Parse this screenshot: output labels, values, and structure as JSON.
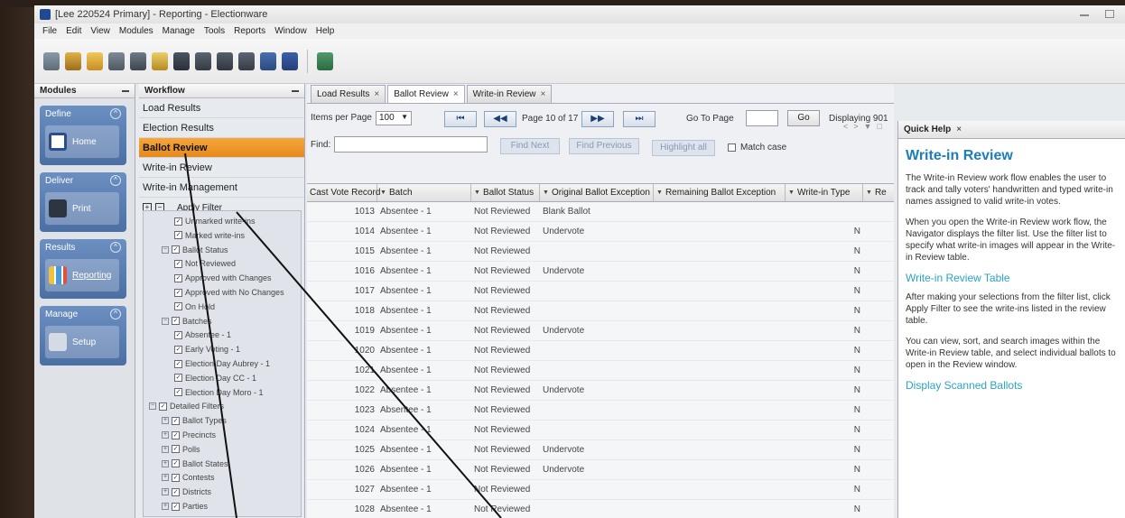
{
  "window": {
    "title": "[Lee 220524 Primary] - Reporting - Electionware"
  },
  "menu": [
    "File",
    "Edit",
    "View",
    "Modules",
    "Manage",
    "Tools",
    "Reports",
    "Window",
    "Help"
  ],
  "modules": {
    "header": "Modules",
    "sections": [
      {
        "title": "Define",
        "button": "Home"
      },
      {
        "title": "Deliver",
        "button": "Print"
      },
      {
        "title": "Results",
        "button": "Reporting"
      },
      {
        "title": "Manage",
        "button": "Setup"
      }
    ]
  },
  "workflow": {
    "header": "Workflow",
    "items": [
      "Load Results",
      "Election Results",
      "Ballot Review",
      "Write-in Review",
      "Write-in Management"
    ],
    "active_index": 2,
    "apply_filter": "Apply Filter"
  },
  "filter_tree": [
    {
      "label": "Unmarked write-ins",
      "indent": 2,
      "checked": true
    },
    {
      "label": "Marked write-ins",
      "indent": 2,
      "checked": true
    },
    {
      "label": "Ballot Status",
      "indent": 1,
      "checked": true,
      "expander": "−"
    },
    {
      "label": "Not Reviewed",
      "indent": 2,
      "checked": true
    },
    {
      "label": "Approved with Changes",
      "indent": 2,
      "checked": true
    },
    {
      "label": "Approved with No Changes",
      "indent": 2,
      "checked": true
    },
    {
      "label": "On Hold",
      "indent": 2,
      "checked": true
    },
    {
      "label": "Batches",
      "indent": 1,
      "checked": true,
      "expander": "−"
    },
    {
      "label": "Absentee - 1",
      "indent": 2,
      "checked": true
    },
    {
      "label": "Early Voting - 1",
      "indent": 2,
      "checked": true
    },
    {
      "label": "Election Day Aubrey - 1",
      "indent": 2,
      "checked": true
    },
    {
      "label": "Election Day CC - 1",
      "indent": 2,
      "checked": true
    },
    {
      "label": "Election Day Moro - 1",
      "indent": 2,
      "checked": true
    },
    {
      "label": "Detailed Filters",
      "indent": 0,
      "checked": true,
      "expander": "−"
    },
    {
      "label": "Ballot Types",
      "indent": 1,
      "checked": true,
      "expander": "+"
    },
    {
      "label": "Precincts",
      "indent": 1,
      "checked": true,
      "expander": "+"
    },
    {
      "label": "Polls",
      "indent": 1,
      "checked": true,
      "expander": "+"
    },
    {
      "label": "Ballot States",
      "indent": 1,
      "checked": true,
      "expander": "+"
    },
    {
      "label": "Contests",
      "indent": 1,
      "checked": true,
      "expander": "+"
    },
    {
      "label": "Districts",
      "indent": 1,
      "checked": true,
      "expander": "+"
    },
    {
      "label": "Parties",
      "indent": 1,
      "checked": true,
      "expander": "+"
    }
  ],
  "tabs": [
    {
      "label": "Load Results",
      "active": false
    },
    {
      "label": "Ballot Review",
      "active": true
    },
    {
      "label": "Write-in Review",
      "active": false
    }
  ],
  "controls": {
    "items_per_page_label": "Items per Page",
    "items_per_page_value": "100",
    "page_indicator": "Page 10 of 17",
    "go_to_page_label": "Go To Page",
    "go_label": "Go",
    "displaying": "Displaying 901",
    "find_label": "Find:",
    "find_next": "Find Next",
    "find_previous": "Find Previous",
    "highlight_all": "Highlight all",
    "match_case": "Match case"
  },
  "grid": {
    "columns": [
      "Cast Vote Record",
      "Batch",
      "Ballot Status",
      "Original Ballot Exception",
      "Remaining Ballot Exception",
      "Write-in Type",
      "Re"
    ],
    "rows": [
      [
        "1013",
        "Absentee - 1",
        "Not Reviewed",
        "Blank Ballot",
        "",
        "",
        ""
      ],
      [
        "1014",
        "Absentee - 1",
        "Not Reviewed",
        "Undervote",
        "",
        "N",
        ""
      ],
      [
        "1015",
        "Absentee - 1",
        "Not Reviewed",
        "",
        "",
        "N",
        ""
      ],
      [
        "1016",
        "Absentee - 1",
        "Not Reviewed",
        "Undervote",
        "",
        "N",
        ""
      ],
      [
        "1017",
        "Absentee - 1",
        "Not Reviewed",
        "",
        "",
        "N",
        ""
      ],
      [
        "1018",
        "Absentee - 1",
        "Not Reviewed",
        "",
        "",
        "N",
        ""
      ],
      [
        "1019",
        "Absentee - 1",
        "Not Reviewed",
        "Undervote",
        "",
        "N",
        ""
      ],
      [
        "1020",
        "Absentee - 1",
        "Not Reviewed",
        "",
        "",
        "N",
        ""
      ],
      [
        "1021",
        "Absentee - 1",
        "Not Reviewed",
        "",
        "",
        "N",
        ""
      ],
      [
        "1022",
        "Absentee - 1",
        "Not Reviewed",
        "Undervote",
        "",
        "N",
        ""
      ],
      [
        "1023",
        "Absentee - 1",
        "Not Reviewed",
        "",
        "",
        "N",
        ""
      ],
      [
        "1024",
        "Absentee - 1",
        "Not Reviewed",
        "",
        "",
        "N",
        ""
      ],
      [
        "1025",
        "Absentee - 1",
        "Not Reviewed",
        "Undervote",
        "",
        "N",
        ""
      ],
      [
        "1026",
        "Absentee - 1",
        "Not Reviewed",
        "Undervote",
        "",
        "N",
        ""
      ],
      [
        "1027",
        "Absentee - 1",
        "Not Reviewed",
        "",
        "",
        "N",
        ""
      ],
      [
        "1028",
        "Absentee - 1",
        "Not Reviewed",
        "",
        "",
        "N",
        ""
      ]
    ]
  },
  "quick_help": {
    "tab": "Quick Help",
    "title": "Write-in Review",
    "p1": "The Write-in Review work flow enables the user to track and tally voters' handwritten and typed write-in names assigned to valid write-in votes.",
    "p2": "When you open the Write-in Review work flow, the Navigator displays the filter list. Use the filter list to specify what write-in images will appear in the Write-in Review table.",
    "h2": "Write-in Review Table",
    "p3": "After making your selections from the filter list, click Apply Filter to see the write-ins listed in the review table.",
    "p4": "You can view, sort, and search images within the Write-in Review table, and select individual ballots to open in the Review window.",
    "h3": "Display Scanned Ballots"
  },
  "colors": {
    "accent": "#e58a1a",
    "module_blue": "#4c6fa3",
    "help_title": "#1a7fb8"
  }
}
